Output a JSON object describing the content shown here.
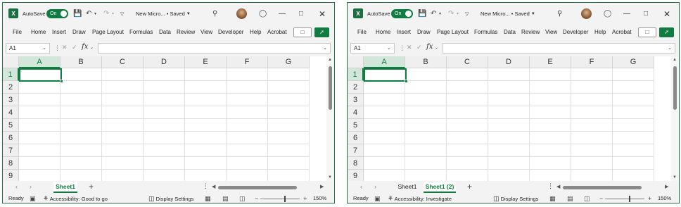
{
  "windows": [
    {
      "title": {
        "autosave_label": "AutoSave",
        "autosave_state": "On",
        "doc_name": "New Micro...",
        "saved_status": "• Saved"
      },
      "menu": [
        "File",
        "Home",
        "Insert",
        "Draw",
        "Page Layout",
        "Formulas",
        "Data",
        "Review",
        "View",
        "Developer",
        "Help",
        "Acrobat"
      ],
      "name_box": "A1",
      "fx_label": "fx",
      "columns": [
        "A",
        "B",
        "C",
        "D",
        "E",
        "F",
        "G"
      ],
      "rows": [
        "1",
        "2",
        "3",
        "4",
        "5",
        "6",
        "7",
        "8",
        "9"
      ],
      "sheet_tabs": [
        {
          "label": "Sheet1",
          "active": true
        }
      ],
      "status": {
        "ready": "Ready",
        "accessibility": "Accessibility: Good to go",
        "display_settings": "Display Settings",
        "zoom": "150%"
      }
    },
    {
      "title": {
        "autosave_label": "AutoSave",
        "autosave_state": "On",
        "doc_name": "New Micro...",
        "saved_status": "• Saved"
      },
      "menu": [
        "File",
        "Home",
        "Insert",
        "Draw",
        "Page Layout",
        "Formulas",
        "Data",
        "Review",
        "View",
        "Developer",
        "Help",
        "Acrobat"
      ],
      "name_box": "A1",
      "fx_label": "fx",
      "columns": [
        "A",
        "B",
        "C",
        "D",
        "E",
        "F",
        "G"
      ],
      "rows": [
        "1",
        "2",
        "3",
        "4",
        "5",
        "6",
        "7",
        "8",
        "9"
      ],
      "sheet_tabs": [
        {
          "label": "Sheet1",
          "active": false
        },
        {
          "label": "Sheet1 (2)",
          "active": true
        }
      ],
      "status": {
        "ready": "Ready",
        "accessibility": "Accessibility: Investigate",
        "display_settings": "Display Settings",
        "zoom": "150%"
      }
    }
  ],
  "colors": {
    "accent": "#107c41",
    "excel_brand": "#1d6f42",
    "window_bg": "#f3f3f3",
    "grid_line": "#e1e1e1",
    "selected_header_bg": "#d2e6da"
  },
  "icons": {
    "excel_logo": "excel-logo-icon",
    "save": "save-icon",
    "undo": "undo-icon",
    "redo": "redo-icon",
    "customize": "customize-toolbar-icon",
    "search": "search-icon",
    "lightbulb": "lightbulb-icon",
    "minimize": "minimize-icon",
    "maximize": "maximize-icon",
    "close": "close-icon",
    "comment": "comment-icon",
    "share": "share-icon"
  }
}
